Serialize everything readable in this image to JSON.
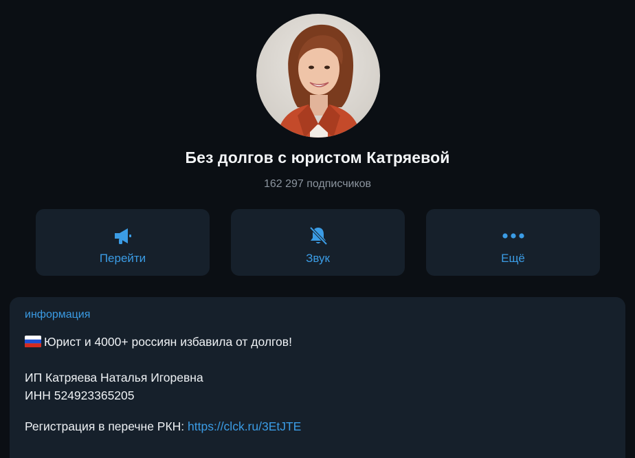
{
  "channel": {
    "title": "Без долгов с юристом Катряевой",
    "subscribers": "162 297 подписчиков"
  },
  "actions": [
    {
      "label": "Перейти",
      "icon": "megaphone-icon"
    },
    {
      "label": "Звук",
      "icon": "bell-muted-icon"
    },
    {
      "label": "Ещё",
      "icon": "more-dots-icon"
    }
  ],
  "info": {
    "heading": "информация",
    "line1": "Юрист и 4000+ россиян избавила от долгов!",
    "flag_icon": "russia-flag-icon",
    "line2": "ИП Катряева Наталья Игоревна",
    "line3": "ИНН 524923365205",
    "line4_prefix": "Регистрация в перечне РКН: ",
    "line4_link": "https://clck.ru/3EtJTE"
  },
  "colors": {
    "background": "#0b0f14",
    "card": "#16202b",
    "accent": "#3b9ce5",
    "muted": "#8c959f"
  }
}
